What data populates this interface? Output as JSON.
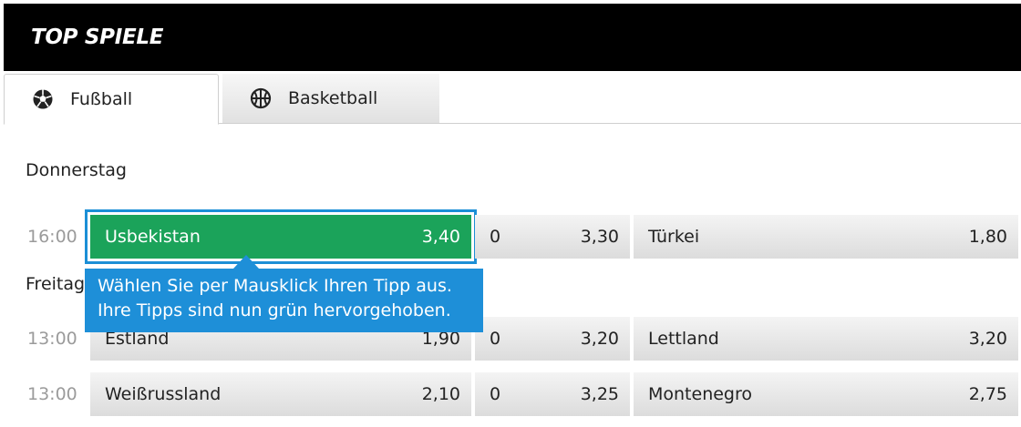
{
  "header": {
    "title": "TOP SPIELE"
  },
  "tabs": [
    {
      "label": "Fußball",
      "icon": "soccer-ball-icon",
      "active": true
    },
    {
      "label": "Basketball",
      "icon": "basketball-icon",
      "active": false
    }
  ],
  "days": [
    {
      "label": "Donnerstag",
      "matches": [
        {
          "time": "16:00",
          "home": "Usbekistan",
          "home_odd": "3,40",
          "draw": "0",
          "draw_odd": "3,30",
          "away": "Türkei",
          "away_odd": "1,80",
          "selected": "home"
        }
      ]
    },
    {
      "label": "Freitag",
      "matches": [
        {
          "time": "13:00",
          "home": "Estland",
          "home_odd": "1,90",
          "draw": "0",
          "draw_odd": "3,20",
          "away": "Lettland",
          "away_odd": "3,20"
        },
        {
          "time": "13:00",
          "home": "Weißrussland",
          "home_odd": "2,10",
          "draw": "0",
          "draw_odd": "3,25",
          "away": "Montenegro",
          "away_odd": "2,75"
        }
      ]
    }
  ],
  "tooltip": {
    "line1": "Wählen Sie per Mausklick Ihren Tipp aus.",
    "line2": "Ihre Tipps sind nun grün hervorgehoben."
  },
  "colors": {
    "header_bg": "#000000",
    "selected_bg": "#1ba35a",
    "selected_border": "#1b8fd6",
    "tooltip_bg": "#1e8fd8",
    "time_text": "#9b9b9b"
  }
}
